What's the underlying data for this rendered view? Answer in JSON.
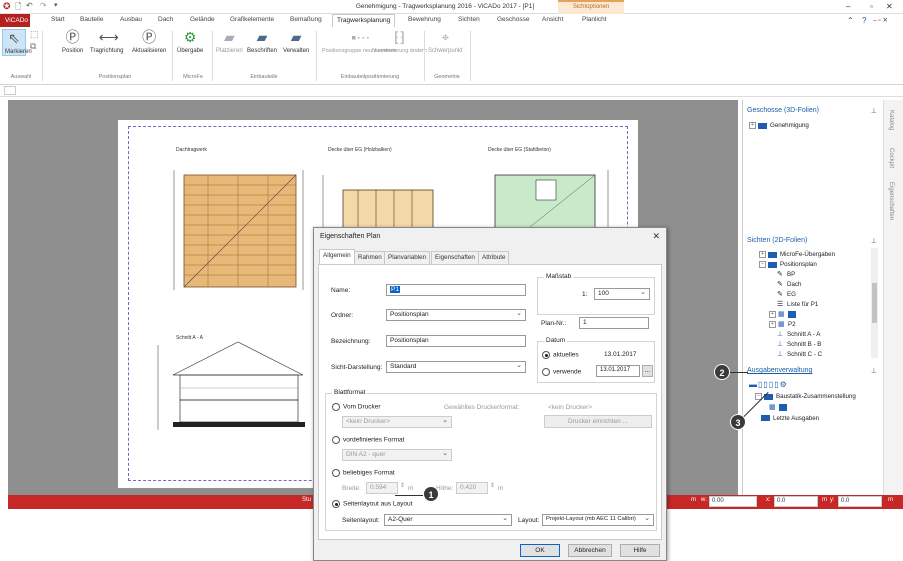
{
  "window": {
    "title": "Genehmigung - Tragwerksplanung 2016 - ViCADo 2017 - [P1]",
    "context_group": "Sichtoptionen",
    "context_tab": "Planlicht"
  },
  "tabs": [
    "ViCADo",
    "Start",
    "Bauteile",
    "Ausbau",
    "Dach",
    "Gelände",
    "Grafikelemente",
    "Bemaßung",
    "Tragwerksplanung",
    "Bewehrung",
    "Sichten",
    "Geschosse",
    "Ansicht"
  ],
  "ribbon": {
    "buttons": [
      "Markieren",
      "Position",
      "Tragrichtung",
      "Aktualisieren",
      "Übergabe",
      "Platzieren",
      "Beschriften",
      "Verwalten",
      "Positionsgruppe neu zuordnen",
      "Nummerierung ändern",
      "Schwerpunkt"
    ],
    "groups": [
      "Auswahl",
      "Positionsplan",
      "MicroFe",
      "Einbauteile",
      "Einbauteilpositionierung",
      "Geometrie"
    ]
  },
  "drawing": {
    "labels": [
      "Dachtragwerk",
      "Decke über EG (Holzbalken)",
      "Decke über EG (Stahlbeton)",
      "Schnitt A - A"
    ]
  },
  "statusbar": {
    "left": "Stu",
    "m_label": "m",
    "w_label": "w:",
    "w_value": "0.00",
    "x_label": "x:",
    "x_value": "0.0",
    "m2_label": "m",
    "y_label": "y:",
    "y_value": "0.0",
    "m3_label": "m"
  },
  "panels": {
    "geschosse": {
      "title": "Geschosse (3D-Folien)",
      "items": [
        "Genehmigung"
      ]
    },
    "sichten": {
      "title": "Sichten (2D-Folien)",
      "items": [
        "MicroFe-Übergaben",
        "Positionsplan",
        "BP",
        "Dach",
        "EG",
        "Liste für P1",
        "",
        "P2",
        "Schnitt A - A",
        "Schnitt B - B",
        "Schnitt C - C"
      ]
    },
    "ausgabe": {
      "title": "Ausgabenverwaltung",
      "items": [
        "Baustatik-Zusammenstellung",
        "",
        "Letzte Ausgaben"
      ]
    },
    "side_tabs": [
      "Katalog",
      "Cockpit",
      "Eigenschaften"
    ]
  },
  "dialog": {
    "title": "Eigenschaften Plan",
    "tabs": [
      "Allgemein",
      "Rahmen",
      "Planvariablen",
      "Eigenschaften",
      "Attribute"
    ],
    "name_label": "Name:",
    "name_value": "P1",
    "ordner_label": "Ordner:",
    "ordner_value": "Positionsplan",
    "bezeichnung_label": "Bezeichnung:",
    "bezeichnung_value": "Positionsplan",
    "sicht_label": "Sicht-Darstellung:",
    "sicht_value": "Standard",
    "massstab_label": "Maßstab",
    "massstab_prefix": "1:",
    "massstab_value": "100",
    "plannr_label": "Plan-Nr.:",
    "plannr_value": "1",
    "datum_label": "Datum",
    "aktuelles_label": "aktuelles",
    "aktuelles_value": "13.01.2017",
    "verwende_label": "verwende",
    "verwende_value": "13.01.2017",
    "dots": "...",
    "blattformat_label": "Blattformat",
    "vom_drucker": "Vom Drucker",
    "gewaehlter_drucker": "Gewähltes Druckerformat:",
    "kein_drucker": "<kein Drucker>",
    "drucker_dropdown": "<kein Drucker>",
    "drucker_btn": "Drucker einrichten ...",
    "vordefiniertes": "vordefiniertes Format",
    "format_value": "DIN A2 - quer",
    "beliebiges": "beliebiges Format",
    "breite_label": "Breite:",
    "breite_value": "0.594",
    "hoehe_label": "Höhe:",
    "hoehe_value": "0.420",
    "unit": "m",
    "seitenlayout_radio": "Seitenlayout aus Layout",
    "seitenlayout_label": "Seitenlayout:",
    "seitenlayout_value": "A2-Quer",
    "layout_label": "Layout:",
    "layout_value": "Projekt-Layout (mb AEC 11 Calibri)",
    "ok": "OK",
    "abbrechen": "Abbrechen",
    "hilfe": "Hilfe"
  },
  "callouts": [
    "1",
    "2",
    "3"
  ]
}
